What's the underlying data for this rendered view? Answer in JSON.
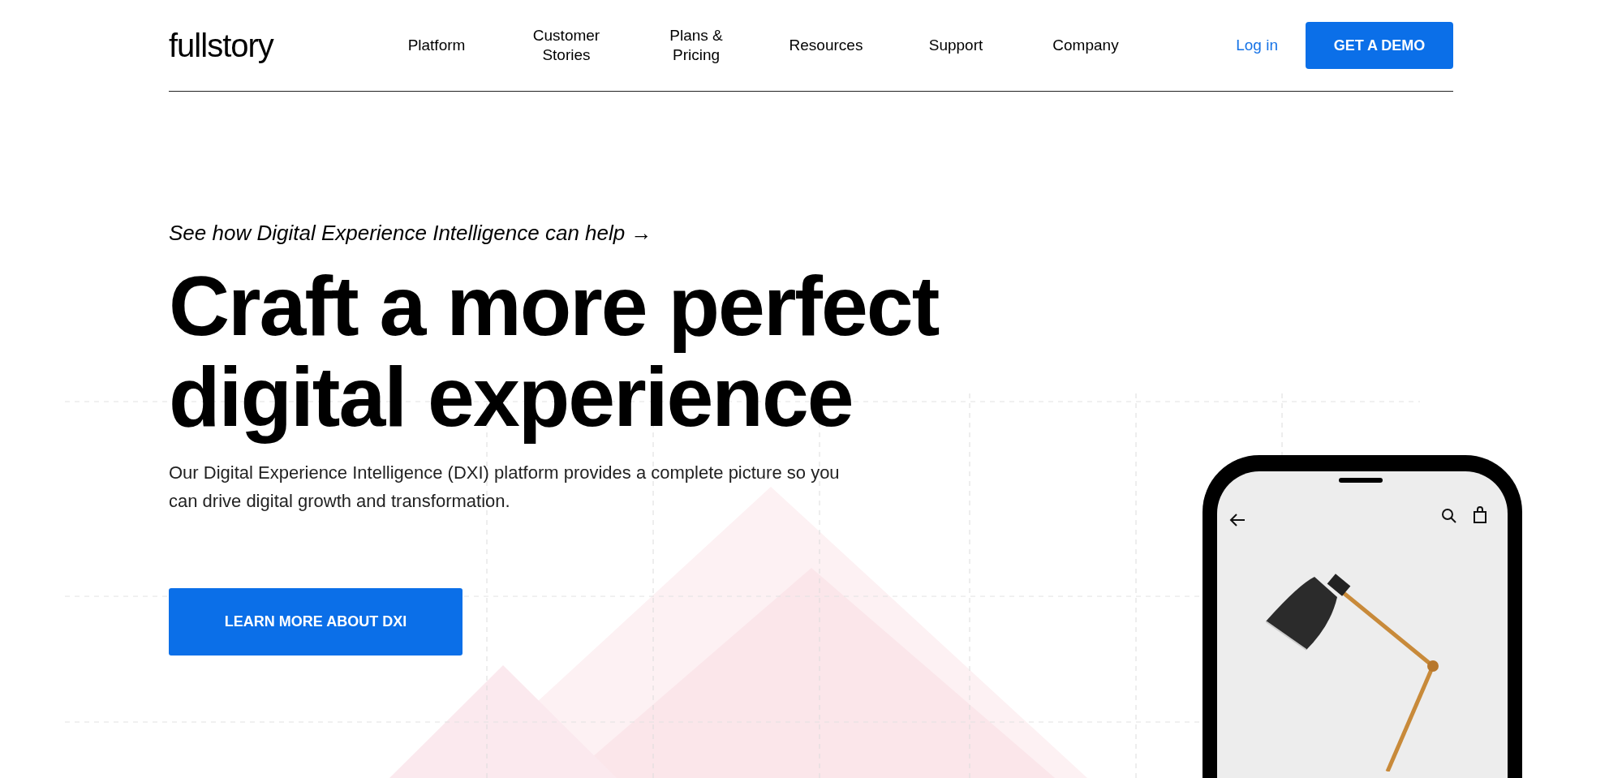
{
  "header": {
    "logo": "fullstory",
    "nav": [
      "Platform",
      "Customer Stories",
      "Plans & Pricing",
      "Resources",
      "Support",
      "Company"
    ],
    "login": "Log in",
    "cta": "GET A DEMO"
  },
  "hero": {
    "tagline": "See how Digital Experience Intelligence can help →",
    "heading_lines": [
      "Craft a more perfect",
      "digital experience"
    ],
    "description": "Our Digital Experience Intelligence (DXI) platform provides a complete picture so you can drive digital growth and transformation.",
    "button": "LEARN MORE ABOUT DXI"
  }
}
